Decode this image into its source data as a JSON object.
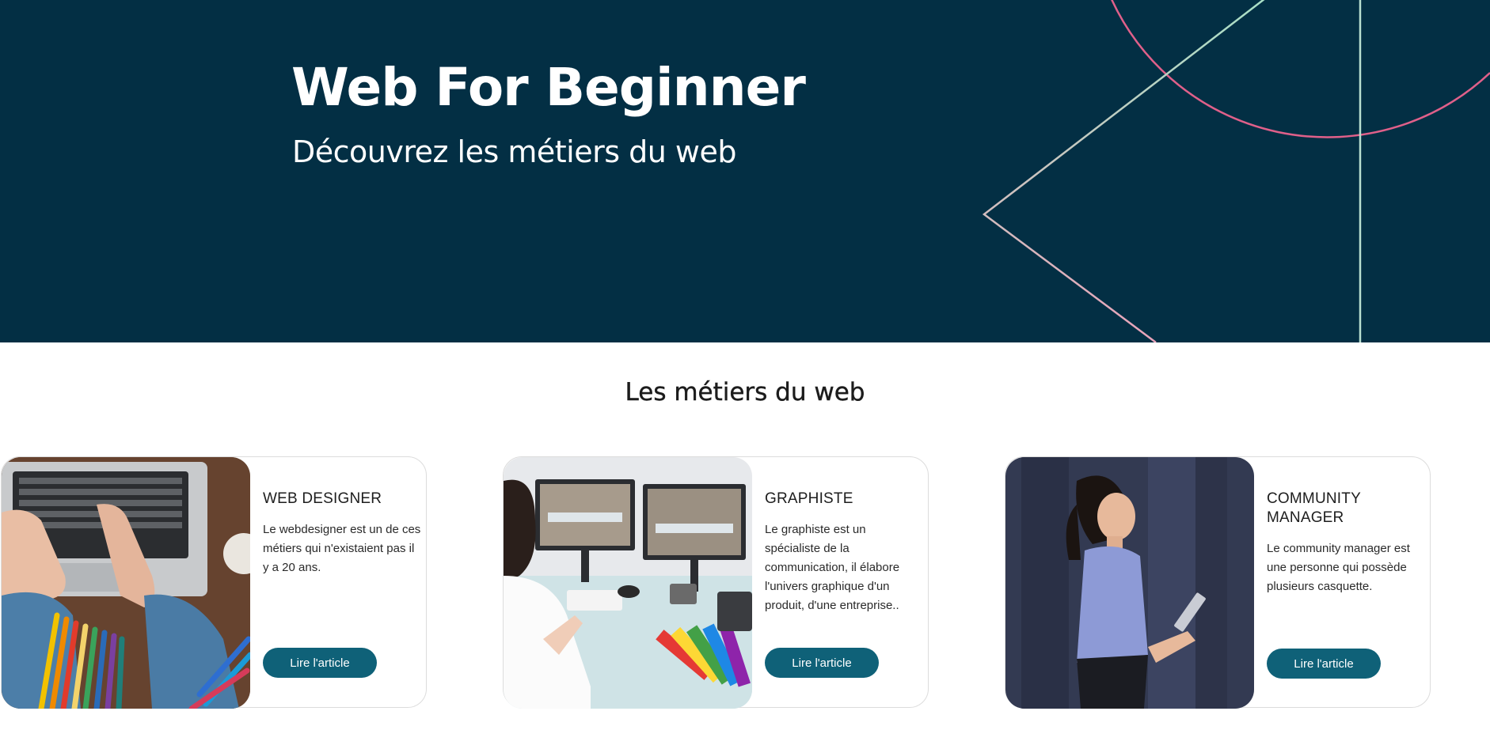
{
  "hero": {
    "title": "Web For Beginner",
    "subtitle": "Découvrez les métiers du web",
    "background_color": "#032f44"
  },
  "section": {
    "title": "Les métiers du web"
  },
  "cards": [
    {
      "title": "WEB DESIGNER",
      "text": "Le webdesigner est un de ces métiers qui n'existaient pas il y a 20 ans.",
      "button_label": "Lire l'article",
      "image": "laptop-typing-with-colored-pencils"
    },
    {
      "title": "GRAPHISTE",
      "text": "Le graphiste est un spécialiste de la communication, il élabore l'univers graphique d'un produit, d'une entreprise..",
      "button_label": "Lire l'article",
      "image": "designer-at-dual-monitor-desk"
    },
    {
      "title": "COMMUNITY MANAGER",
      "text": "Le community manager est une personne qui possède plusieurs casquette.",
      "button_label": "Lire l'article",
      "image": "woman-holding-tablet"
    }
  ],
  "colors": {
    "button": "#0f6178",
    "accent_pink": "#e0608a",
    "accent_green": "#9fdcbf"
  }
}
